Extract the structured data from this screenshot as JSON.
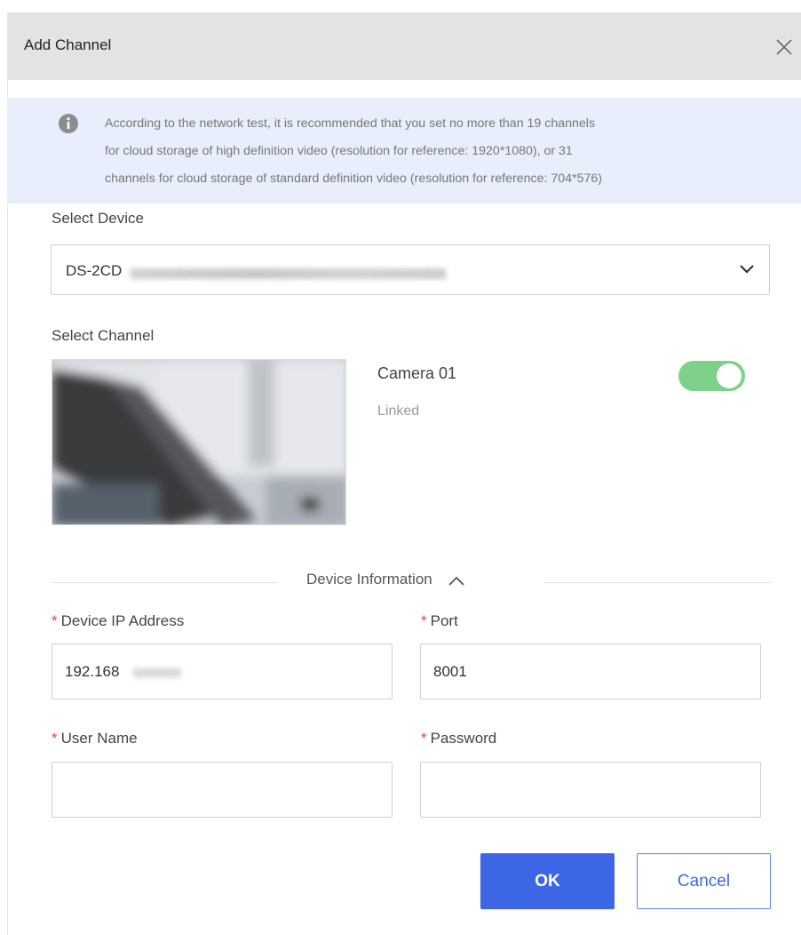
{
  "dialog": {
    "title": "Add Channel",
    "close_icon": "close-icon"
  },
  "notice": {
    "icon": "info-icon",
    "line1": "According to the network test, it is recommended that you set no more than 19 channels",
    "line2": "for cloud storage of high definition video (resolution for reference: 1920*1080), or 31",
    "line3": "channels for cloud storage of standard definition video (resolution for reference: 704*576)"
  },
  "device": {
    "label": "Select Device",
    "value": "DS-2CD",
    "dropdown_icon": "chevron-down-icon"
  },
  "channel": {
    "label": "Select Channel",
    "camera_name": "Camera 01",
    "status": "Linked",
    "enabled": true
  },
  "device_info": {
    "toggle_label": "Device Information",
    "expanded": true,
    "ip": {
      "required_mark": "*",
      "label": "Device IP Address",
      "value": "192.168"
    },
    "port": {
      "required_mark": "*",
      "label": "Port",
      "value": "8001"
    },
    "username": {
      "required_mark": "*",
      "label": "User Name",
      "value": ""
    },
    "password": {
      "required_mark": "*",
      "label": "Password",
      "value": ""
    }
  },
  "buttons": {
    "ok": "OK",
    "cancel": "Cancel"
  },
  "colors": {
    "header_bg": "#e3e3e3",
    "notice_bg": "#e8eefb",
    "primary": "#3d66e6",
    "toggle_on": "#7ed08a",
    "required": "#e0463a"
  }
}
